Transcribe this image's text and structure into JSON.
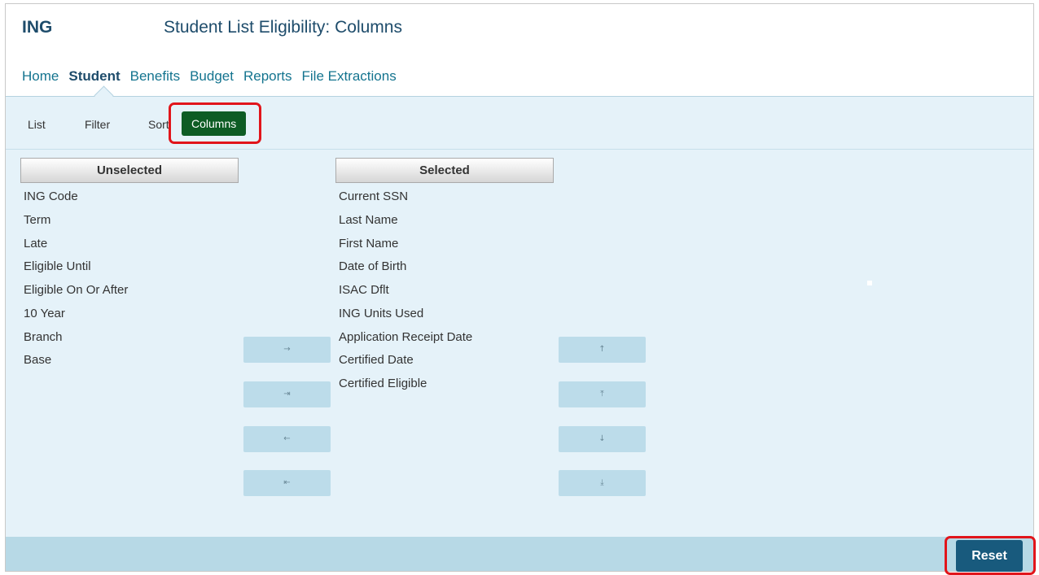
{
  "header": {
    "app_code": "ING",
    "page_title": "Student List Eligibility: Columns"
  },
  "nav": {
    "items": [
      {
        "label": "Home",
        "active": false
      },
      {
        "label": "Student",
        "active": true
      },
      {
        "label": "Benefits",
        "active": false
      },
      {
        "label": "Budget",
        "active": false
      },
      {
        "label": "Reports",
        "active": false
      },
      {
        "label": "File Extractions",
        "active": false
      }
    ]
  },
  "subnav": {
    "list": "List",
    "filter": "Filter",
    "sort": "Sort",
    "columns": "Columns",
    "active": "Columns"
  },
  "unselected": {
    "header": "Unselected",
    "items": [
      "ING Code",
      "Term",
      "Late",
      "Eligible Until",
      "Eligible On Or After",
      "10 Year",
      "Branch",
      "Base"
    ]
  },
  "selected": {
    "header": "Selected",
    "items": [
      "Current SSN",
      "Last Name",
      "First Name",
      "Date of Birth",
      "ISAC Dflt",
      "ING Units Used",
      "Application Receipt Date",
      "Certified Date",
      "Certified Eligible"
    ]
  },
  "move_buttons": {
    "add": {
      "icon": "arrow-right-icon",
      "glyph": "→"
    },
    "add_all": {
      "icon": "arrow-right-to-bar-icon",
      "glyph": "⇥"
    },
    "remove": {
      "icon": "arrow-left-icon",
      "glyph": "←"
    },
    "remove_all": {
      "icon": "arrow-left-to-bar-icon",
      "glyph": "⇤"
    }
  },
  "order_buttons": {
    "up": {
      "icon": "arrow-up-icon",
      "glyph": "↑"
    },
    "top": {
      "icon": "arrow-to-top-icon",
      "glyph": "⤒"
    },
    "down": {
      "icon": "arrow-down-icon",
      "glyph": "↓"
    },
    "bottom": {
      "icon": "arrow-to-bottom-icon",
      "glyph": "⤓"
    }
  },
  "footer": {
    "reset_label": "Reset"
  },
  "colors": {
    "title": "#1e4c6b",
    "nav_link": "#14748f",
    "panel_bg": "#e5f2f9",
    "active_tab_bg": "#0d5c24",
    "footer_bg": "#b7d9e6",
    "reset_bg": "#185a7d",
    "highlight": "#e1151b"
  }
}
